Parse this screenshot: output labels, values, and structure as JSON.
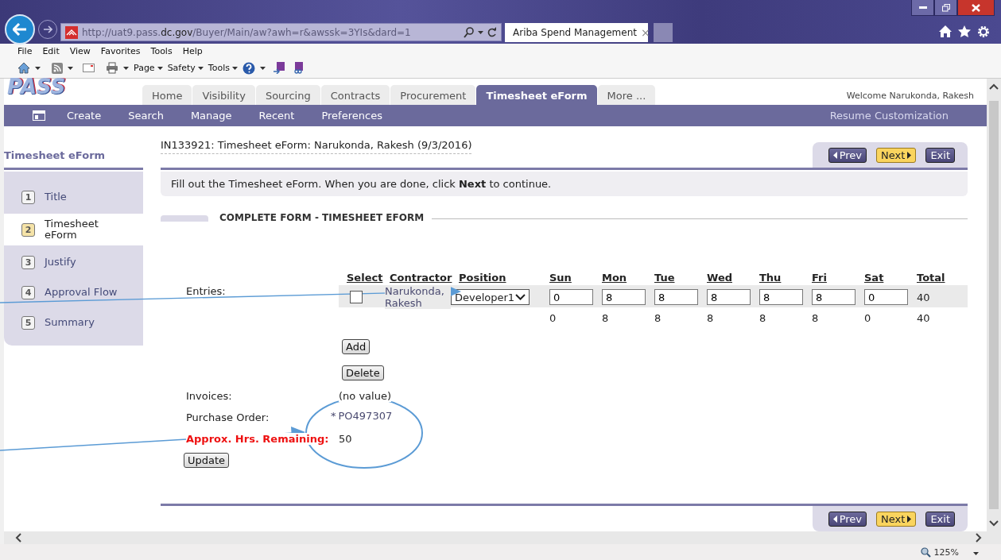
{
  "browser": {
    "address": "http://uat9.pass.**dc.gov**/Buyer/Main/aw?awh=r&awssk=3YIs&dard=1",
    "tab": {
      "title": "Ariba Spend Management",
      "close": "×"
    },
    "menu": [
      "File",
      "Edit",
      "View",
      "Favorites",
      "Tools",
      "Help"
    ],
    "commands": [
      "Page",
      "Safety",
      "Tools"
    ],
    "zoom": "125%"
  },
  "header": {
    "logo": "PASS",
    "tabs": [
      {
        "label": "Home",
        "selected": false
      },
      {
        "label": "Visibility",
        "selected": false
      },
      {
        "label": "Sourcing",
        "selected": false
      },
      {
        "label": "Contracts",
        "selected": false
      },
      {
        "label": "Procurement",
        "selected": false
      },
      {
        "label": "Timesheet eForm",
        "selected": true
      },
      {
        "label": "More ...",
        "selected": false
      }
    ],
    "welcome": "Welcome Narukonda, Rakesh"
  },
  "nav": {
    "items": [
      "Create",
      "Search",
      "Manage",
      "Recent",
      "Preferences"
    ],
    "resume": "Resume Customization"
  },
  "sidebar": {
    "title": "Timesheet eForm",
    "steps": [
      {
        "number": "1",
        "label": "Title",
        "selected": false
      },
      {
        "number": "2",
        "label": "Timesheet eForm",
        "selected": true
      },
      {
        "number": "3",
        "label": "Justify",
        "selected": false
      },
      {
        "number": "4",
        "label": "Approval Flow",
        "selected": false
      },
      {
        "number": "5",
        "label": "Summary",
        "selected": false
      }
    ]
  },
  "main": {
    "title": "IN133921: Timesheet eForm: Narukonda, Rakesh (9/3/2016)",
    "top_buttons": [
      {
        "label": "Prev",
        "kind": "prev"
      },
      {
        "label": "Next",
        "kind": "next"
      },
      {
        "label": "Exit",
        "kind": "exit"
      }
    ],
    "instruction": "Fill out the Timesheet eForm. When you are done, click **Next** to continue.",
    "section_title": "COMPLETE FORM - TIMESHEET EFORM",
    "form": {
      "entries_label": "Entries:",
      "columns": [
        "Select",
        "Contractor",
        "Position",
        "Sun",
        "Mon",
        "Tue",
        "Wed",
        "Thu",
        "Fri",
        "Sat",
        "Total"
      ],
      "rows": [
        {
          "checked": false,
          "contractor": "Narukonda, Rakesh",
          "position": "Developer1",
          "days": [
            "0",
            "8",
            "8",
            "8",
            "8",
            "8",
            "0"
          ],
          "total": "40"
        }
      ],
      "totals": [
        "0",
        "8",
        "8",
        "8",
        "8",
        "8",
        "0",
        "40"
      ],
      "add": "Add",
      "delete": "Delete",
      "invoices": {
        "label": "Invoices:",
        "value": "(no value)"
      },
      "purchase_order": {
        "label": "Purchase Order:",
        "required_mark": "*",
        "value": "PO497307"
      },
      "hours_remaining": {
        "label": "Approx. Hrs. Remaining:",
        "value": "50"
      },
      "update": "Update"
    },
    "bottom_buttons": [
      {
        "label": "Prev",
        "kind": "prev"
      },
      {
        "label": "Next",
        "kind": "next"
      },
      {
        "label": "Exit",
        "kind": "exit"
      }
    ]
  }
}
